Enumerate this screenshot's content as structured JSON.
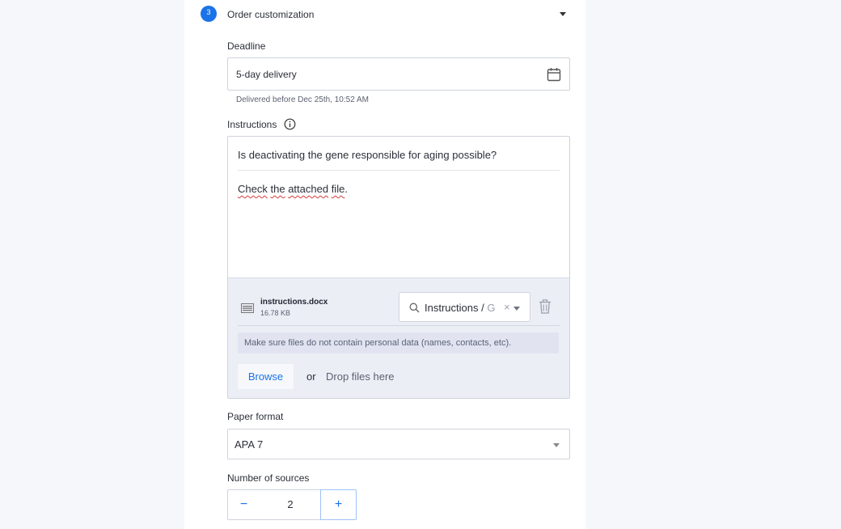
{
  "step": {
    "number": "3",
    "title": "Order customization"
  },
  "deadline": {
    "label": "Deadline",
    "value": "5-day delivery",
    "helper": "Delivered before Dec 25th, 10:52 AM"
  },
  "instructions": {
    "label": "Instructions",
    "question": "Is deactivating the gene responsible for aging possible?",
    "body_part1": "Check",
    "body_part2": "the",
    "body_part3": "attached",
    "body_part4": "file",
    "body_end": "."
  },
  "attachment": {
    "file_name": "instructions.docx",
    "file_size": "16.78 KB",
    "category_value": "Instructions / G",
    "category_visible": "Instructions / ",
    "category_fade": "G",
    "clear_glyph": "×",
    "privacy_note": "Make sure files do not contain personal data (names, contacts, etc).",
    "browse_label": "Browse",
    "or_text": "or",
    "drop_text": "Drop files here"
  },
  "paper_format": {
    "label": "Paper format",
    "value": "APA 7"
  },
  "sources": {
    "label": "Number of sources",
    "value": "2",
    "minus": "−",
    "plus": "+"
  },
  "colors": {
    "accent": "#1a73e8",
    "attach_bg": "#eceef6",
    "spell_error": "#d43b3b"
  },
  "icons": {
    "calendar": "calendar-icon",
    "info": "info-icon",
    "file": "document-file-icon",
    "search": "search-icon",
    "trash": "trash-icon",
    "dropdown": "chevron-down-icon"
  }
}
